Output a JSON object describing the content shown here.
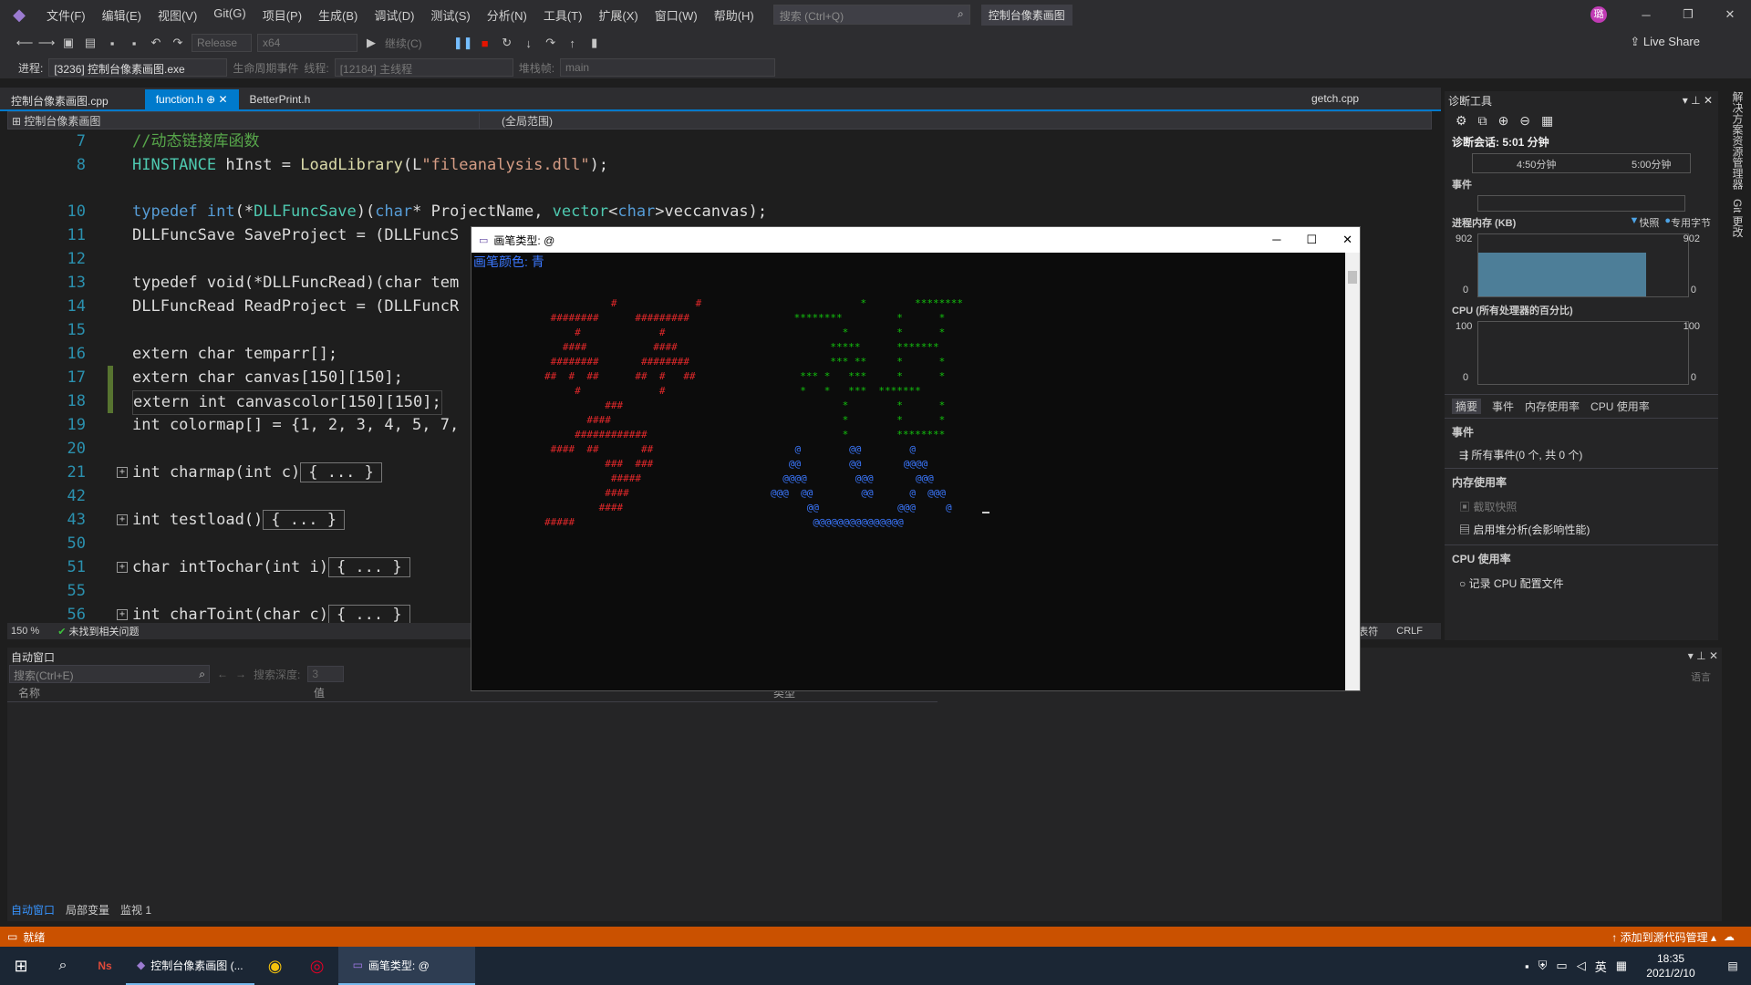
{
  "menubar": {
    "items": [
      "文件(F)",
      "编辑(E)",
      "视图(V)",
      "Git(G)",
      "项目(P)",
      "生成(B)",
      "调试(D)",
      "测试(S)",
      "分析(N)",
      "工具(T)",
      "扩展(X)",
      "窗口(W)",
      "帮助(H)"
    ],
    "search_placeholder": "搜索 (Ctrl+Q)",
    "app_title": "控制台像素画图",
    "avatar_initial": "璐"
  },
  "toolbar": {
    "config": "Release",
    "platform": "x64",
    "continue": "继续(C)",
    "live_share": "Live Share"
  },
  "debugbar": {
    "process_label": "进程:",
    "process_value": "[3236] 控制台像素画图.exe",
    "lifecycle": "生命周期事件",
    "thread_label": "线程:",
    "thread_value": "[12184] 主线程",
    "stack_label": "堆栈帧:",
    "stack_value": "main"
  },
  "tabs": [
    {
      "label": "控制台像素画图.cpp",
      "active": false
    },
    {
      "label": "function.h",
      "active": true
    },
    {
      "label": "BetterPrint.h",
      "active": false
    }
  ],
  "right_tab": "getch.cpp",
  "navbar": {
    "project": "控制台像素画图",
    "scope": "(全局范围)"
  },
  "editor": {
    "line_numbers": [
      "7",
      "8",
      "10",
      "11",
      "12",
      "13",
      "14",
      "15",
      "16",
      "17",
      "18",
      "19",
      "20",
      "21",
      "42",
      "43",
      "50",
      "51",
      "55",
      "56"
    ],
    "lines": [
      "//动态链接库函数",
      "HINSTANCE hInst = LoadLibrary(L\"fileanalysis.dll\");",
      "",
      "typedef int(*DLLFuncSave)(char* ProjectName, vector<char>veccanvas);",
      "DLLFuncSave SaveProject = (DLLFuncS",
      "",
      "typedef void(*DLLFuncRead)(char tem",
      "DLLFuncRead ReadProject = (DLLFuncR",
      "",
      "extern char temparr[];",
      "extern char canvas[150][150];",
      "extern int canvascolor[150][150];",
      "int colormap[] = {1, 2, 3, 4, 5, 7,",
      "",
      "int charmap(int c)",
      "",
      "int testload()",
      "",
      "char intTochar(int i)",
      "",
      "int charToint(char c)"
    ],
    "collapsed_label": "{ ... }",
    "zoom": "150 %",
    "status": "未找到相关问题",
    "line_ending": "CRLF",
    "tab_mode": "制表符"
  },
  "diagnostics": {
    "title": "诊断工具",
    "session": "诊断会话: 5:01 分钟",
    "timeline_ticks": [
      "4:50分钟",
      "5:00分钟"
    ],
    "events_header": "事件",
    "memory_header": "进程内存 (KB)",
    "legend_snapshot": "快照",
    "legend_private": "专用字节",
    "memory_max": "902",
    "memory_min": "0",
    "memory_level": 1.0,
    "cpu_header": "CPU (所有处理器的百分比)",
    "cpu_max": "100",
    "cpu_min": "0",
    "tabs": [
      "摘要",
      "事件",
      "内存使用率",
      "CPU 使用率"
    ],
    "sec_events": "事件",
    "all_events": "所有事件(0 个, 共 0 个)",
    "sec_memory": "内存使用率",
    "take_snapshot": "截取快照",
    "heap_profile": "启用堆分析(会影响性能)",
    "sec_cpu": "CPU 使用率",
    "record_cpu": "记录 CPU 配置文件"
  },
  "autos": {
    "title": "自动窗口",
    "search_placeholder": "搜索(Ctrl+E)",
    "depth_label": "搜索深度:",
    "depth_value": "3",
    "col_name": "名称",
    "col_value": "值",
    "col_type": "类型",
    "bottom_tabs": [
      "自动窗口",
      "局部变量",
      "监视 1"
    ],
    "right_label": "语言"
  },
  "vertical_tabs": [
    "解决方案资源管理器",
    "Git 更改"
  ],
  "statusbar": {
    "ready": "就绪",
    "source_control": "添加到源代码管理"
  },
  "console": {
    "title": "画笔类型: @",
    "color_line": "画笔颜色: 青",
    "red_art": "           #             #\n ########      #########\n     #             #\n   ####           ####\n ########       ########\n##  #  ##      ##  #   ##\n     #             #\n          ###\n       ####\n     ############\n ####  ##       ##\n          ###  ###\n           #####\n          ####\n         ####\n#####",
    "green_art": "            *        ********\n ********         *      *\n         *        *      *\n       *****      *******\n       *** **     *      *\n  *** *   ***     *      *\n  *   *   ***  *******\n         *        *      *\n         *        *      *\n         *        ********",
    "blue_art": "    @        @@        @\n   @@        @@       @@@@\n  @@@@        @@@       @@@\n@@@  @@        @@      @  @@@\n      @@             @@@     @\n       @@@@@@@@@@@@@@@"
  },
  "taskbar": {
    "vs_label": "控制台像素画图 (...",
    "console_label": "画笔类型: @",
    "ime": "英",
    "time": "18:35",
    "date": "2021/2/10"
  },
  "colors": {
    "accent": "#007acc",
    "status": "#ca5100",
    "keyword": "#569cd6",
    "comment": "#57a64a",
    "red_art": "#e0282a",
    "green_art": "#13c20e",
    "blue_art": "#3b78ff"
  }
}
